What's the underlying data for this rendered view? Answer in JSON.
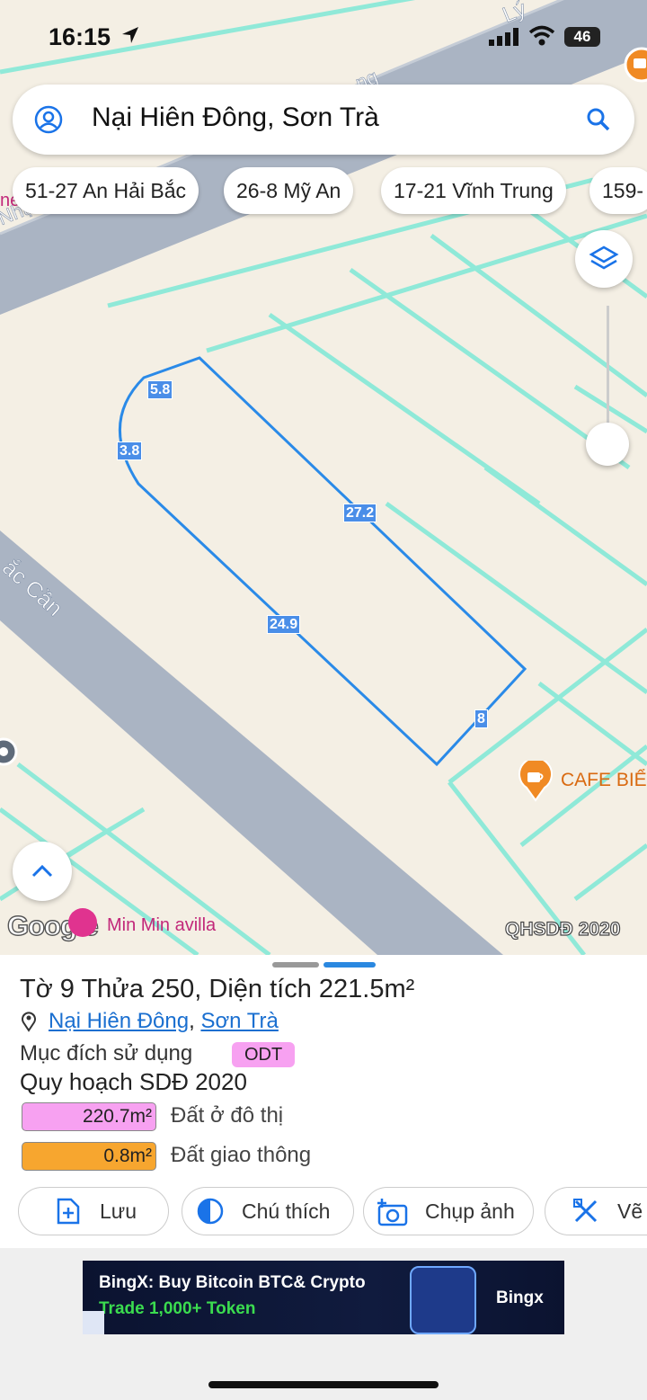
{
  "status_bar": {
    "time": "16:15",
    "battery": "46"
  },
  "search": {
    "text": "Nại Hiên Đông, Sơn Trà"
  },
  "chips": [
    "51-27 An Hải Bắc",
    "26-8 Mỹ An",
    "17-21 Vĩnh Trung",
    "159-"
  ],
  "map": {
    "street_labels": [
      "Nhật Quang",
      "ng",
      "Lý",
      "ắc Cần"
    ],
    "pois": {
      "cafe": "CAFE BIỂ",
      "villa": "Min Min avilla",
      "edge_text": "ne"
    },
    "dimensions": [
      "5.8",
      "3.8",
      "27.2",
      "24.9",
      "8"
    ],
    "watermark": "Google",
    "layer_label": "QHSDĐ 2020"
  },
  "sheet": {
    "title": "Tờ 9 Thửa 250, Diện tích 221.5m²",
    "address": {
      "ward": "Nại Hiên Đông",
      "separator": ", ",
      "district": "Sơn Trà"
    },
    "purpose_label": "Mục đích sử dụng",
    "purpose_code": "ODT",
    "plan_title": "Quy hoạch SDĐ 2020",
    "legend": [
      {
        "area": "220.7m²",
        "label": "Đất ở đô thị",
        "color": "#f7a1f1"
      },
      {
        "area": "0.8m²",
        "label": "Đất giao thông",
        "color": "#f7a62f"
      }
    ],
    "actions": {
      "save": "Lưu",
      "legend": "Chú thích",
      "photo": "Chụp ảnh",
      "draw": "Vẽ"
    }
  },
  "ad": {
    "line1": "BingX: Buy Bitcoin BTC& Crypto",
    "line2": "Trade 1,000+ Token",
    "brand": "Bingx"
  },
  "colors": {
    "accent": "#1a73e8",
    "parcel_outline": "#2a8ae8",
    "cadastral_lines": "#7ee8d6",
    "road": "#aab4c3"
  }
}
